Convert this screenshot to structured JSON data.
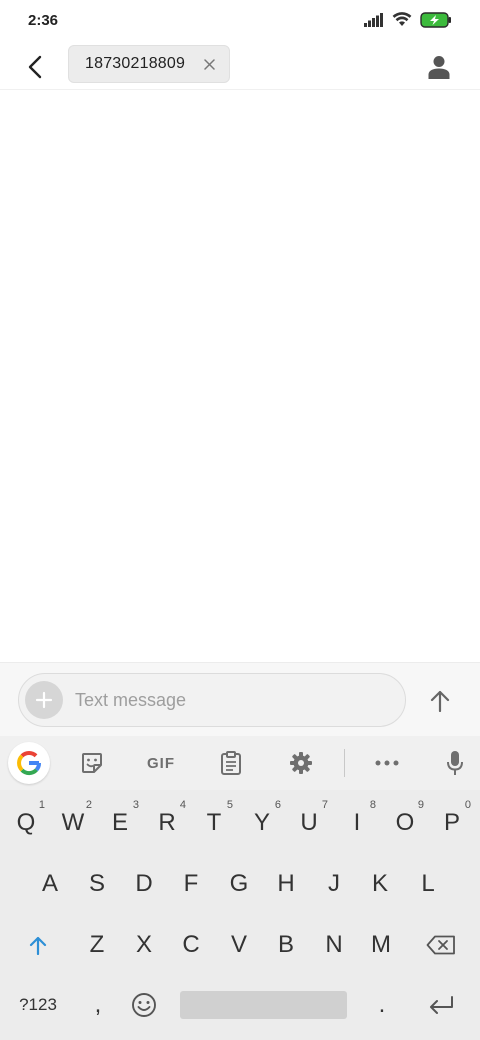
{
  "status_bar": {
    "time": "2:36",
    "icons": [
      "signal-icon",
      "wifi-icon",
      "battery-charging-icon"
    ],
    "battery_color": "#3cba3c"
  },
  "header": {
    "back_icon": "back-arrow-icon",
    "recipient": "18730218809",
    "remove_icon": "close-icon",
    "contact_icon": "person-icon"
  },
  "compose": {
    "placeholder": "Text message",
    "attach_icon": "plus-icon",
    "send_icon": "arrow-up-icon"
  },
  "keyboard": {
    "toolbar": {
      "gif_label": "GIF",
      "tools": [
        "google-icon",
        "sticker-icon",
        "gif-icon",
        "clipboard-icon",
        "gear-icon",
        "more-icon",
        "mic-icon"
      ]
    },
    "rows": [
      [
        {
          "label": "Q",
          "hint": "1"
        },
        {
          "label": "W",
          "hint": "2"
        },
        {
          "label": "E",
          "hint": "3"
        },
        {
          "label": "R",
          "hint": "4"
        },
        {
          "label": "T",
          "hint": "5"
        },
        {
          "label": "Y",
          "hint": "6"
        },
        {
          "label": "U",
          "hint": "7"
        },
        {
          "label": "I",
          "hint": "8"
        },
        {
          "label": "O",
          "hint": "9"
        },
        {
          "label": "P",
          "hint": "0"
        }
      ],
      [
        {
          "label": "A"
        },
        {
          "label": "S"
        },
        {
          "label": "D"
        },
        {
          "label": "F"
        },
        {
          "label": "G"
        },
        {
          "label": "H"
        },
        {
          "label": "J"
        },
        {
          "label": "K"
        },
        {
          "label": "L"
        }
      ],
      [
        {
          "label": "Z"
        },
        {
          "label": "X"
        },
        {
          "label": "C"
        },
        {
          "label": "V"
        },
        {
          "label": "B"
        },
        {
          "label": "N"
        },
        {
          "label": "M"
        }
      ]
    ],
    "bottom_row": {
      "symbols_label": "?123",
      "comma_label": ",",
      "period_label": "."
    },
    "accent_color": "#2d8fd6"
  }
}
